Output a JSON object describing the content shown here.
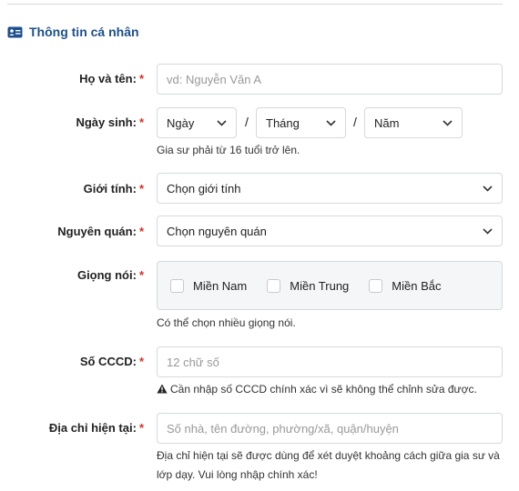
{
  "section": {
    "title": "Thông tin cá nhân",
    "icon": "id-card-icon"
  },
  "fields": {
    "fullname": {
      "label": "Họ và tên:",
      "required": "*",
      "placeholder": "vd: Nguyễn Văn A"
    },
    "birthday": {
      "label": "Ngày sinh:",
      "required": "*",
      "day": "Ngày",
      "month": "Tháng",
      "year": "Năm",
      "separator": "/",
      "hint": "Gia sư phải từ 16 tuổi trở lên."
    },
    "gender": {
      "label": "Giới tính:",
      "required": "*",
      "value": "Chọn giới tính"
    },
    "hometown": {
      "label": "Nguyên quán:",
      "required": "*",
      "value": "Chọn nguyên quán"
    },
    "accent": {
      "label": "Giọng nói:",
      "required": "*",
      "options": [
        "Miền Nam",
        "Miền Trung",
        "Miền Bắc"
      ],
      "hint": "Có thể chọn nhiều giọng nói."
    },
    "id_number": {
      "label": "Số CCCD:",
      "required": "*",
      "placeholder": "12 chữ số",
      "hint": "Cần nhập số CCCD chính xác vì sẽ không thể chỉnh sửa được."
    },
    "address": {
      "label": "Địa chỉ hiện tại:",
      "required": "*",
      "placeholder": "Số nhà, tên đường, phường/xã, quận/huyện",
      "hint": "Địa chỉ hiện tại sẽ được dùng để xét duyệt khoảng cách giữa gia sư và lớp dạy. Vui lòng nhập chính xác!"
    }
  },
  "colors": {
    "accent": "#1d4f8c",
    "required": "#d93025",
    "border": "#d6d9de"
  }
}
